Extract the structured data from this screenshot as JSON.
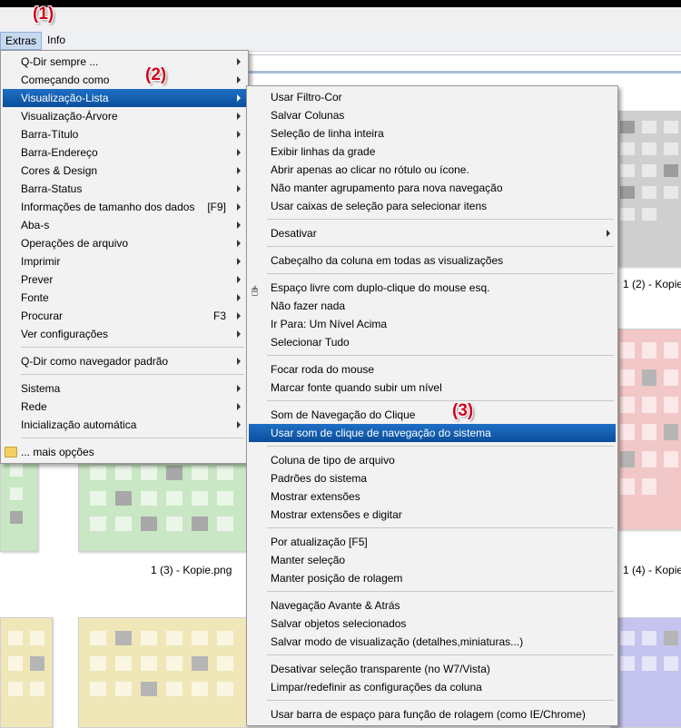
{
  "annotations": [
    "(1)",
    "(2)",
    "(3)"
  ],
  "menubar": {
    "items": [
      {
        "label": "Extras"
      },
      {
        "label": "Info"
      }
    ]
  },
  "files": {
    "captions": [
      "1 (2) - Kopie",
      "1 (3) - Kopie.png",
      "1 (4) - Kopie"
    ]
  },
  "extras_menu": {
    "items": [
      {
        "label": "Q-Dir sempre ...",
        "submenu": true
      },
      {
        "label": "Começando como",
        "submenu": true
      },
      {
        "label": "Visualização-Lista",
        "submenu": true,
        "highlighted": true
      },
      {
        "label": "Visualização-Árvore",
        "submenu": true
      },
      {
        "label": "Barra-Título",
        "submenu": true
      },
      {
        "label": "Barra-Endereço",
        "submenu": true
      },
      {
        "label": "Cores & Design",
        "submenu": true
      },
      {
        "label": "Barra-Status",
        "submenu": true
      },
      {
        "label": "Informações de tamanho dos dados",
        "shortcut": "[F9]",
        "submenu": true
      },
      {
        "label": "Aba-s",
        "submenu": true
      },
      {
        "label": "Operações de arquivo",
        "submenu": true
      },
      {
        "label": "Imprimir",
        "submenu": true
      },
      {
        "label": "Prever",
        "submenu": true
      },
      {
        "label": "Fonte",
        "submenu": true
      },
      {
        "label": "Procurar",
        "shortcut": "F3",
        "submenu": true
      },
      {
        "label": "Ver configurações",
        "submenu": true
      },
      {
        "label": "Q-Dir como navegador padrão",
        "submenu": true
      },
      {
        "label": "Sistema",
        "submenu": true
      },
      {
        "label": "Rede",
        "submenu": true
      },
      {
        "label": "Inicialização automática",
        "submenu": true
      },
      {
        "label": "... mais opções",
        "icon": "folder-icon"
      }
    ]
  },
  "list_view_menu": {
    "items": [
      {
        "label": "Usar Filtro-Cor"
      },
      {
        "label": "Salvar Colunas"
      },
      {
        "label": "Seleção de linha inteira"
      },
      {
        "label": "Exibir linhas da grade"
      },
      {
        "label": "Abrir apenas ao clicar no rótulo ou ícone."
      },
      {
        "label": "Não manter agrupamento para nova navegação"
      },
      {
        "label": "Usar caixas de seleção para selecionar itens"
      },
      {
        "label": "Desativar",
        "submenu": true
      },
      {
        "label": "Cabeçalho da coluna em todas as visualizações"
      },
      {
        "label": "Espaço livre com duplo-clique do mouse esq.",
        "icon": "mouse-icon"
      },
      {
        "label": "Não fazer nada"
      },
      {
        "label": "Ir Para: Um Nível Acima"
      },
      {
        "label": "Selecionar Tudo"
      },
      {
        "label": "Focar roda do mouse"
      },
      {
        "label": "Marcar fonte quando subir um nível"
      },
      {
        "label": "Som de Navegação do Clique"
      },
      {
        "label": "Usar som de clique de navegação do sistema",
        "highlighted": true
      },
      {
        "label": "Coluna de tipo de arquivo"
      },
      {
        "label": "Padrões do sistema"
      },
      {
        "label": "Mostrar extensões"
      },
      {
        "label": "Mostrar extensões e digitar"
      },
      {
        "label": "Por atualização [F5]"
      },
      {
        "label": "Manter seleção"
      },
      {
        "label": "Manter posição de rolagem"
      },
      {
        "label": "Navegação Avante & Atrás"
      },
      {
        "label": "Salvar objetos selecionados"
      },
      {
        "label": "Salvar modo de visualização (detalhes,miniaturas...)"
      },
      {
        "label": "Desativar seleção transparente (no W7/Vista)"
      },
      {
        "label": "Limpar/redefinir as configurações da coluna"
      },
      {
        "label": "Usar barra de espaço para função de rolagem (como IE/Chrome)"
      }
    ]
  }
}
